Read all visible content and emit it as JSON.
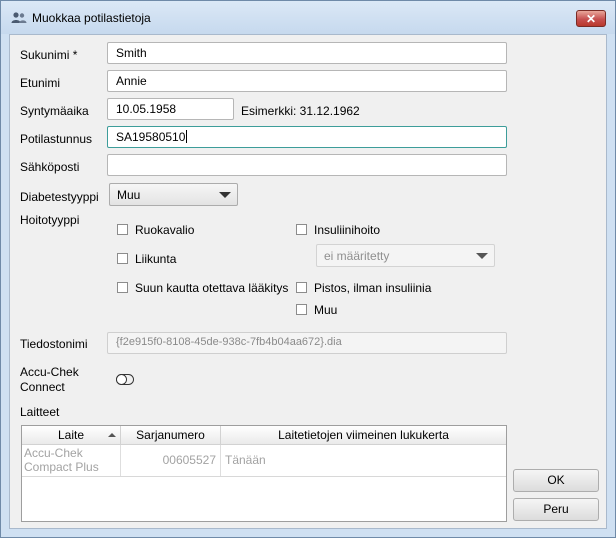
{
  "window": {
    "title": "Muokkaa potilastietoja",
    "close_label": "✕"
  },
  "form": {
    "surname_label": "Sukunimi *",
    "surname_value": "Smith",
    "firstname_label": "Etunimi",
    "firstname_value": "Annie",
    "birthdate_label": "Syntymäaika",
    "birthdate_value": "10.05.1958",
    "birthdate_example": "Esimerkki: 31.12.1962",
    "patientid_label": "Potilastunnus",
    "patientid_value": "SA19580510",
    "email_label": "Sähköposti",
    "email_value": "",
    "diabetes_label": "Diabetestyyppi",
    "diabetes_value": "Muu",
    "treatment_label": "Hoitotyyppi",
    "filename_label": "Tiedostonimi",
    "filename_value": "{f2e915f0-8108-45de-938c-7fb4b04aa672}.dia",
    "accuchek_label_line1": "Accu-Chek",
    "accuchek_label_line2": "Connect",
    "devices_label": "Laitteet"
  },
  "treatment_options": {
    "diet": "Ruokavalio",
    "exercise": "Liikunta",
    "oral": "Suun kautta otettava lääkitys",
    "insulin": "Insuliinihoito",
    "insulin_select": "ei määritetty",
    "injection": "Pistos, ilman insuliinia",
    "other": "Muu"
  },
  "devices_table": {
    "columns": [
      "Laite",
      "Sarjanumero",
      "Laitetietojen viimeinen lukukerta"
    ],
    "rows": [
      {
        "device_line1": "Accu-Chek",
        "device_line2": "Compact Plus",
        "serial": "00605527",
        "last_read": "Tänään"
      }
    ]
  },
  "buttons": {
    "ok": "OK",
    "cancel": "Peru"
  },
  "colors": {
    "focus_border": "#3d9d9a",
    "title_bar": "#c6d9ee",
    "close_button": "#c75050"
  }
}
